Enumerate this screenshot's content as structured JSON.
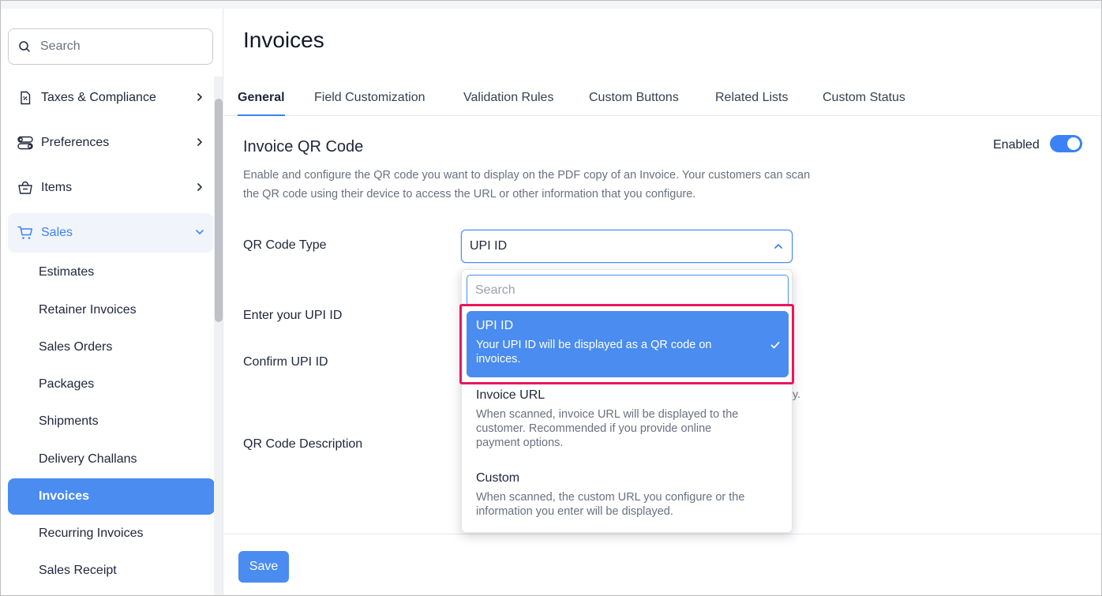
{
  "sidebar": {
    "search_placeholder": "Search",
    "items": [
      {
        "label": "Taxes & Compliance",
        "icon": "document-percent-icon"
      },
      {
        "label": "Preferences",
        "icon": "toggles-icon"
      },
      {
        "label": "Items",
        "icon": "basket-icon"
      },
      {
        "label": "Sales",
        "icon": "cart-icon"
      }
    ],
    "sales_sub": [
      "Estimates",
      "Retainer Invoices",
      "Sales Orders",
      "Packages",
      "Shipments",
      "Delivery Challans",
      "Invoices",
      "Recurring Invoices",
      "Sales Receipt"
    ]
  },
  "main": {
    "title": "Invoices",
    "tabs": [
      "General",
      "Field Customization",
      "Validation Rules",
      "Custom Buttons",
      "Related Lists",
      "Custom Status"
    ],
    "section_title": "Invoice QR Code",
    "section_desc_line1": "Enable and configure the QR code you want to display on the PDF copy of an Invoice. Your customers can scan",
    "section_desc_line2": "the QR code using their device to access the URL or other information that you configure.",
    "enabled_label": "Enabled",
    "toggle_on": true,
    "fields": {
      "qr_type_label": "QR Code Type",
      "upi_label": "Enter your UPI ID",
      "confirm_label": "Confirm UPI ID",
      "desc_label": "QR Code Description"
    },
    "qr_type_value": "UPI ID",
    "hint_tail": "y.",
    "save_label": "Save"
  },
  "dropdown": {
    "search_placeholder": "Search",
    "options": [
      {
        "title": "UPI ID",
        "desc_1": "Your UPI ID will be displayed as a QR code on",
        "desc_2": "invoices."
      },
      {
        "title": "Invoice URL",
        "desc_1": "When scanned, invoice URL will be displayed to the",
        "desc_2": "customer. Recommended if you provide online",
        "desc_3": "payment options."
      },
      {
        "title": "Custom",
        "desc_1": "When scanned, the custom URL you configure or the",
        "desc_2": "information you enter will be displayed."
      }
    ]
  },
  "colors": {
    "accent": "#4a8cf0",
    "highlight": "#e8175d"
  }
}
